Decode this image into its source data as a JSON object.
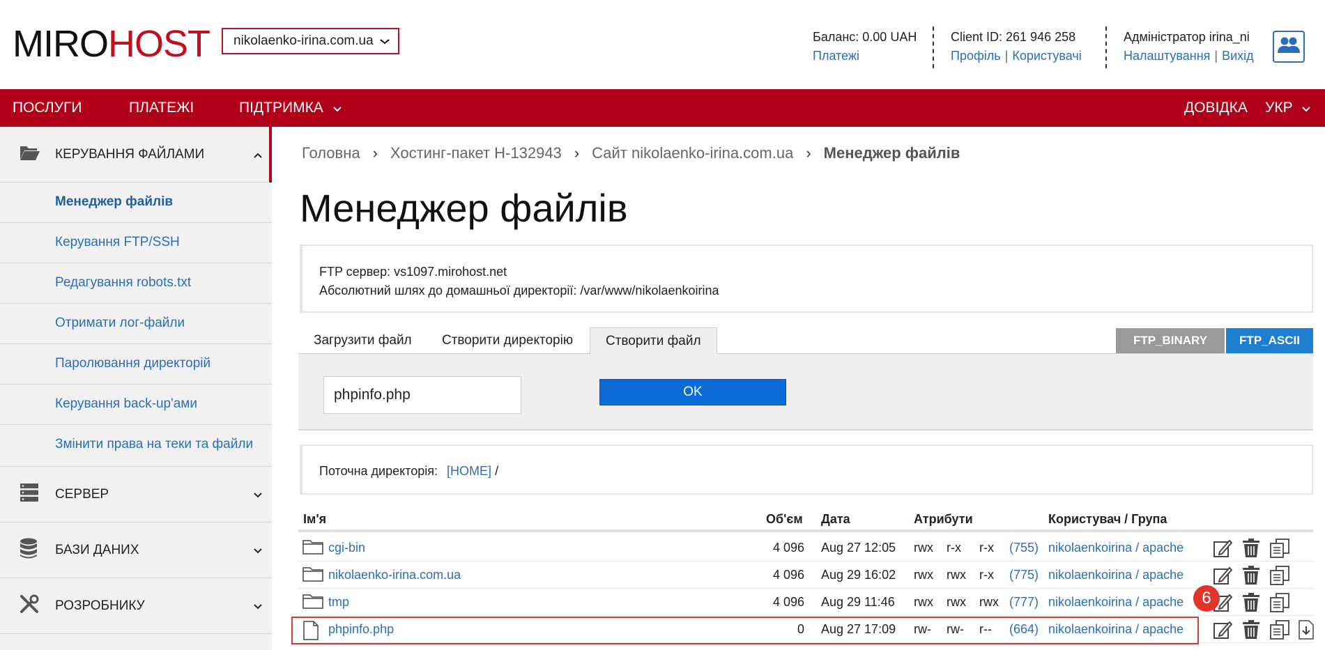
{
  "header": {
    "logo_part1": "MIRO",
    "logo_part2": "HOST",
    "domain_selector": "nikolaenko-irina.com.ua",
    "balance_label": "Баланс: 0.00 UAH",
    "payments_link": "Платежі",
    "client_id": "Client ID: 261 946 258",
    "profile_link": "Профіль",
    "users_link": "Користувачі",
    "admin_label": "Адміністратор irina_ni",
    "settings_link": "Налаштування",
    "logout_link": "Вихід",
    "separator": "|"
  },
  "nav": {
    "services": "ПОСЛУГИ",
    "payments": "ПЛАТЕЖІ",
    "support": "ПІДТРИМКА",
    "help": "ДОВІДКА",
    "language": "УКР"
  },
  "sidebar": {
    "file_management": "КЕРУВАННЯ ФАЙЛАМИ",
    "items": [
      {
        "label": "Менеджер файлів",
        "active": true
      },
      {
        "label": "Керування FTP/SSH",
        "active": false
      },
      {
        "label": "Редагування robots.txt",
        "active": false
      },
      {
        "label": "Отримати лог-файли",
        "active": false
      },
      {
        "label": "Паролювання директорій",
        "active": false
      },
      {
        "label": "Керування back-up'ами",
        "active": false
      },
      {
        "label": "Змінити права на теки та файли",
        "active": false
      }
    ],
    "server": "СЕРВЕР",
    "databases": "БАЗИ ДАНИХ",
    "developer": "РОЗРОБНИКУ"
  },
  "breadcrumb": {
    "home": "Головна",
    "package": "Хостинг-пакет H-132943",
    "site": "Сайт nikolaenko-irina.com.ua",
    "current": "Менеджер файлів",
    "sep": "›"
  },
  "page_title": "Менеджер файлів",
  "info": {
    "ftp_server": "FTP сервер: vs1097.mirohost.net",
    "home_path": "Абсолютний шлях до домашньої директорії: /var/www/nikolaenkoirina"
  },
  "tabs": {
    "upload": "Загрузити файл",
    "create_dir": "Створити директорію",
    "create_file": "Створити файл"
  },
  "ftp_modes": {
    "binary": "FTP_BINARY",
    "ascii": "FTP_ASCII"
  },
  "create_form": {
    "filename_value": "phpinfo.php",
    "ok_label": "OK"
  },
  "current_dir": {
    "label": "Поточна директорія:",
    "home": "[HOME]",
    "slash": "/"
  },
  "table": {
    "headers": {
      "name": "Ім'я",
      "size": "Об'єм",
      "date": "Дата",
      "attrs": "Атрибути",
      "owner": "Користувач / Група"
    },
    "rows": [
      {
        "type": "folder",
        "name": "cgi-bin",
        "size": "4 096",
        "date": "Aug 27 12:05",
        "u": "rwx",
        "g": "r-x",
        "o": "r-x",
        "octal": "(755)",
        "owner": "nikolaenkoirina / apache"
      },
      {
        "type": "folder",
        "name": "nikolaenko-irina.com.ua",
        "size": "4 096",
        "date": "Aug 29 16:02",
        "u": "rwx",
        "g": "rwx",
        "o": "r-x",
        "octal": "(775)",
        "owner": "nikolaenkoirina / apache"
      },
      {
        "type": "folder",
        "name": "tmp",
        "size": "4 096",
        "date": "Aug 29 11:46",
        "u": "rwx",
        "g": "rwx",
        "o": "rwx",
        "octal": "(777)",
        "owner": "nikolaenkoirina / apache"
      },
      {
        "type": "file",
        "name": "phpinfo.php",
        "size": "0",
        "date": "Aug 27 17:09",
        "u": "rw-",
        "g": "rw-",
        "o": "r--",
        "octal": "(664)",
        "owner": "nikolaenkoirina / apache"
      }
    ]
  },
  "annotation_badge": "6",
  "colors": {
    "brand_red": "#b0001a",
    "link_blue": "#2a6ebb",
    "ok_blue": "#0a6ad8",
    "ftp_binary_gray": "#9a9a9a",
    "ftp_ascii_blue": "#1e7fd0",
    "highlight_red": "#d9382f"
  }
}
